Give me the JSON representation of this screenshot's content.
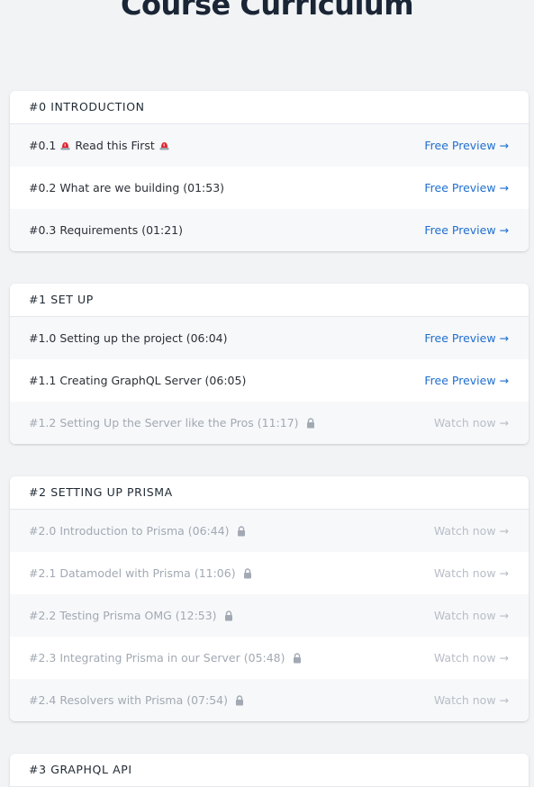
{
  "page": {
    "title": "Course Curriculum"
  },
  "sections": [
    {
      "title": "#0 INTRODUCTION",
      "lessons": [
        {
          "prefix": "#0.1",
          "title": "Read this First",
          "action": "Free Preview →",
          "locked": false,
          "alarm": true
        },
        {
          "title": "#0.2 What are we building (01:53)",
          "action": "Free Preview →",
          "locked": false
        },
        {
          "title": "#0.3 Requirements (01:21)",
          "action": "Free Preview →",
          "locked": false
        }
      ]
    },
    {
      "title": "#1 SET UP",
      "lessons": [
        {
          "title": "#1.0 Setting up the project (06:04)",
          "action": "Free Preview →",
          "locked": false
        },
        {
          "title": "#1.1 Creating GraphQL Server (06:05)",
          "action": "Free Preview →",
          "locked": false
        },
        {
          "title": "#1.2 Setting Up the Server like the Pros (11:17)",
          "action": "Watch now →",
          "locked": true
        }
      ]
    },
    {
      "title": "#2 SETTING UP PRISMA",
      "lessons": [
        {
          "title": "#2.0 Introduction to Prisma (06:44)",
          "action": "Watch now →",
          "locked": true
        },
        {
          "title": "#2.1 Datamodel with Prisma (11:06)",
          "action": "Watch now →",
          "locked": true
        },
        {
          "title": "#2.2 Testing Prisma OMG (12:53)",
          "action": "Watch now →",
          "locked": true
        },
        {
          "title": "#2.3 Integrating Prisma in our Server (05:48)",
          "action": "Watch now →",
          "locked": true
        },
        {
          "title": "#2.4 Resolvers with Prisma (07:54)",
          "action": "Watch now →",
          "locked": true
        }
      ]
    },
    {
      "title": "#3 GRAPHQL API",
      "lessons": []
    }
  ],
  "colors": {
    "link": "#1f6fcf",
    "locked_text": "#a2a9b3",
    "background": "#f1f3f5",
    "alarm_red": "#e0242f"
  },
  "icons": {
    "lock": "lock-icon",
    "alarm": "police-light-icon"
  }
}
